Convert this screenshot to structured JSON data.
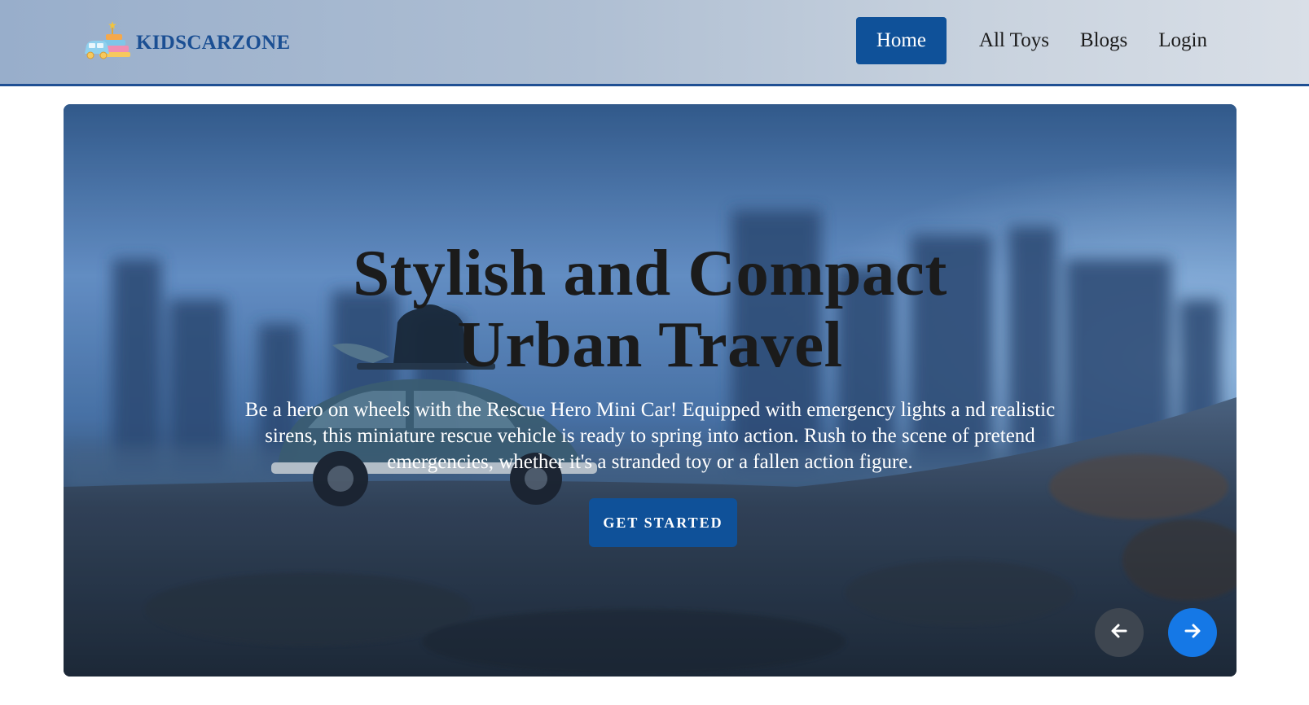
{
  "brand": {
    "name": "KIDSCARZONE",
    "logo_icon": "toy-car-stack-icon"
  },
  "nav": {
    "items": [
      {
        "label": "Home",
        "active": true
      },
      {
        "label": "All Toys",
        "active": false
      },
      {
        "label": "Blogs",
        "active": false
      },
      {
        "label": "Login",
        "active": false
      }
    ]
  },
  "hero": {
    "title_line1": "Stylish and Compact",
    "title_line2": "Urban Travel",
    "description": "Be a hero on wheels with the Rescue Hero Mini Car! Equipped with emergency lights a nd realistic sirens, this miniature rescue vehicle is ready to spring into action. Rush to the scene of pretend emergencies, whether it's a stranded toy or a fallen action figure.",
    "cta_label": "GET STARTED",
    "prev_icon": "arrow-left-icon",
    "next_icon": "arrow-right-icon"
  },
  "colors": {
    "primary": "#0f5199",
    "brand_text": "#1b4f93",
    "next_button": "#1578e6",
    "prev_button": "#3e4650"
  }
}
